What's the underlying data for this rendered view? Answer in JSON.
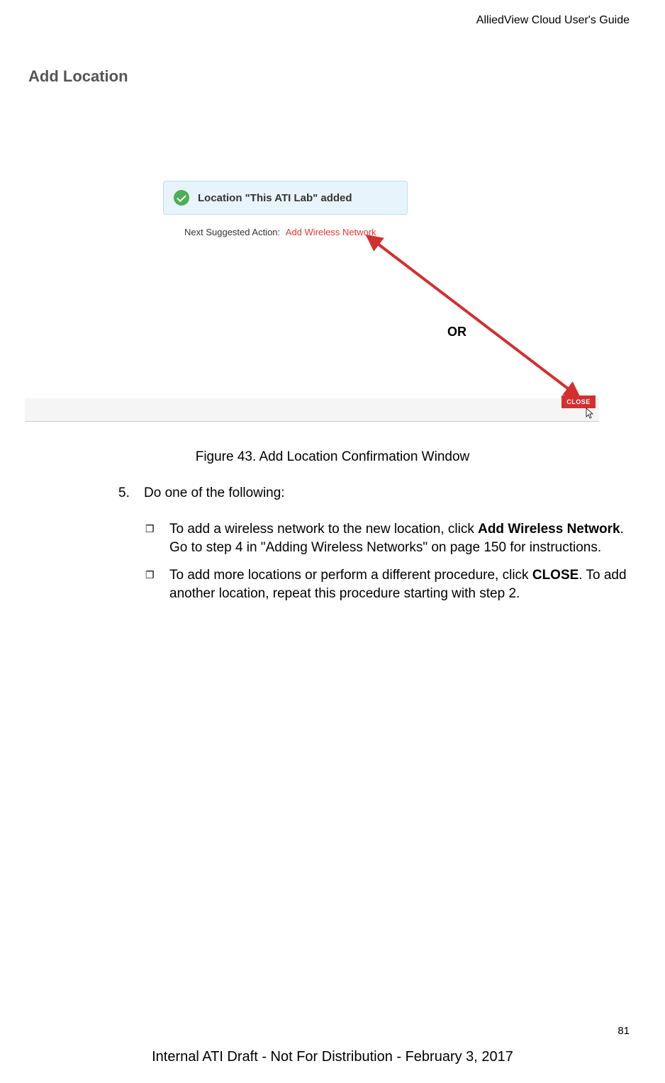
{
  "header": "AlliedView Cloud User's Guide",
  "screenshot": {
    "dialog_title": "Add Location",
    "success_message": "Location \"This ATI Lab\" added",
    "next_label": "Next Suggested Action:",
    "next_link": "Add Wireless Network",
    "or_text": "OR",
    "close_button": "CLOSE"
  },
  "figure_caption": "Figure 43. Add Location Confirmation Window",
  "step": {
    "num": "5.",
    "text": "Do one of the following:"
  },
  "bullets": [
    {
      "pre": "To add a wireless network to the new location, click ",
      "bold": "Add Wireless Network",
      "post": ". Go to step 4 in \"Adding Wireless Networks\" on page 150 for instructions."
    },
    {
      "pre": "To add more locations or perform a different procedure, click ",
      "bold": "CLOSE",
      "post": ". To add another location, repeat this procedure starting with step 2."
    }
  ],
  "page_num": "81",
  "footer": "Internal ATI Draft - Not For Distribution - February 3, 2017"
}
